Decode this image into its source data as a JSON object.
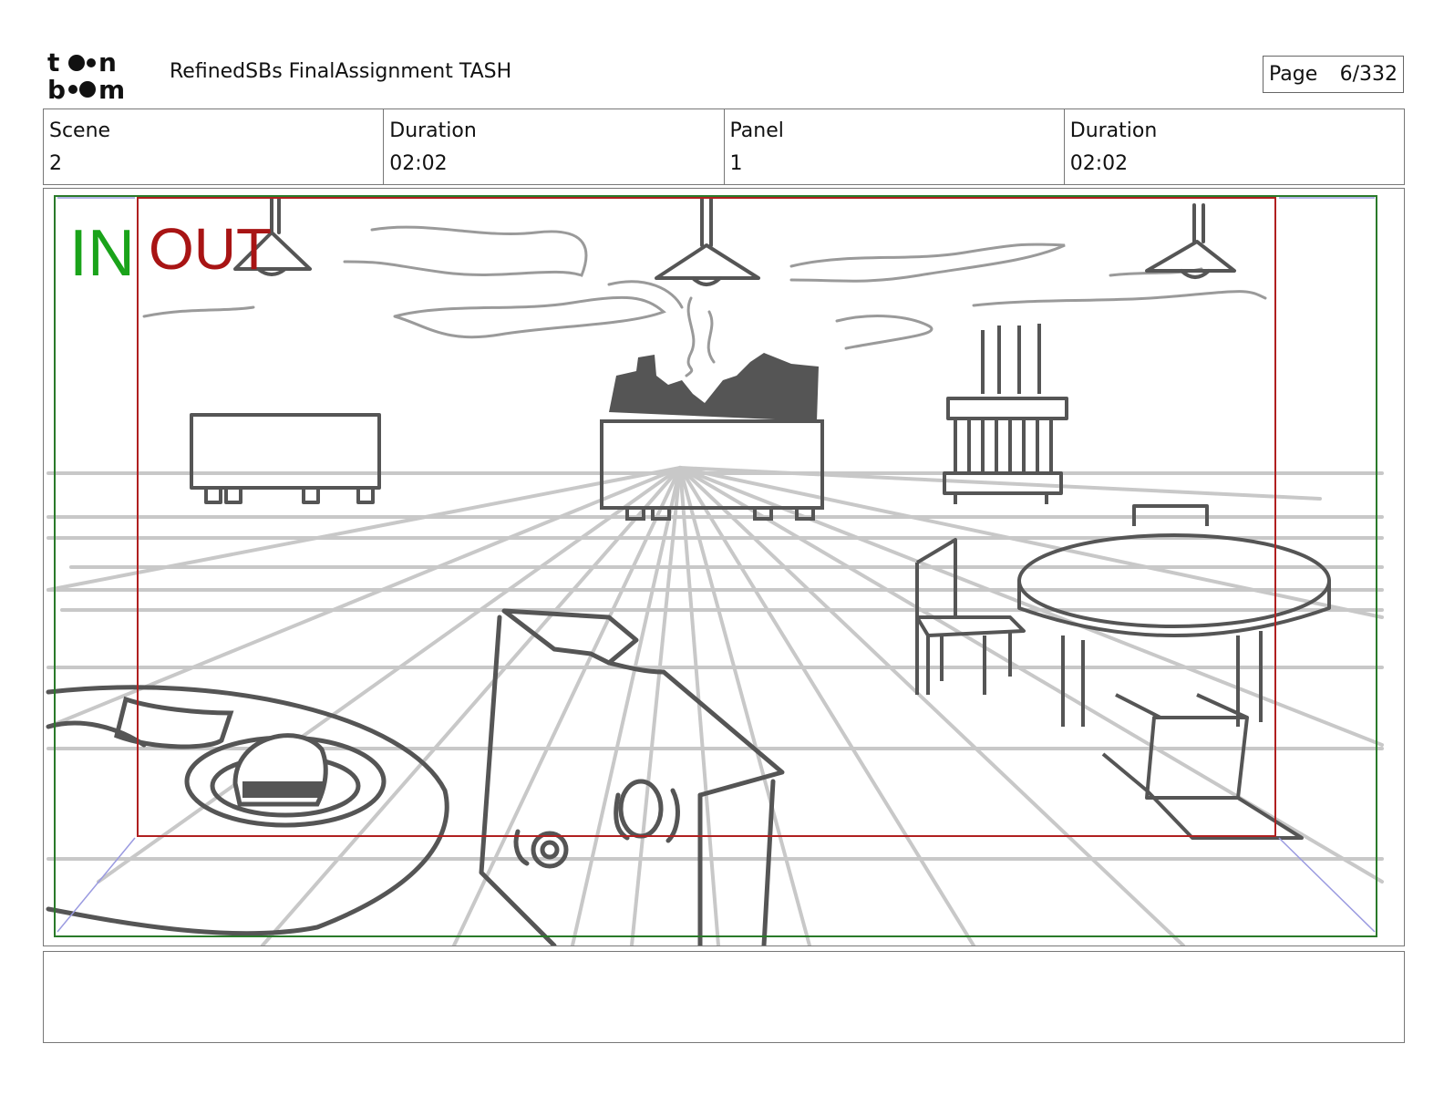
{
  "header": {
    "title": "RefinedSBs FinalAssignment TASH",
    "page_label": "Page",
    "page_number": "6/332"
  },
  "info": {
    "scene_label": "Scene",
    "scene_value": "2",
    "scene_duration_label": "Duration",
    "scene_duration_value": "02:02",
    "panel_label": "Panel",
    "panel_value": "1",
    "panel_duration_label": "Duration",
    "panel_duration_value": "02:02"
  },
  "panel": {
    "in_label": "IN",
    "out_label": "OUT",
    "in_color": "#1aa31a",
    "out_color": "#a81414",
    "safe_frame_color": "#2a7a2a",
    "camera_frame_color": "#b02020"
  },
  "notes": {
    "text": ""
  }
}
